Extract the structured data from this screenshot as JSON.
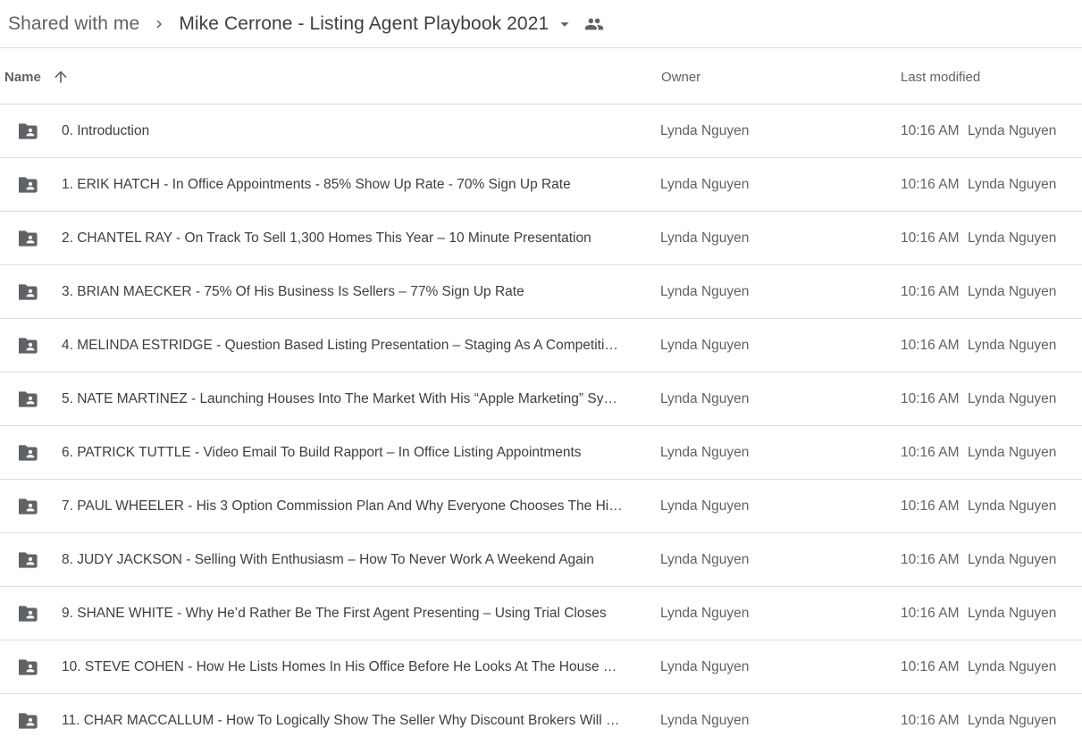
{
  "breadcrumb": {
    "parent": "Shared with me",
    "current": "Mike Cerrone - Listing Agent Playbook 2021",
    "separator_icon": "chevron-right-icon",
    "dropdown_icon": "caret-down-icon",
    "shared_icon": "people-icon"
  },
  "header": {
    "name": "Name",
    "sort_icon": "arrow-up-icon",
    "owner": "Owner",
    "last_modified": "Last modified"
  },
  "colors": {
    "text_primary": "#3c4043",
    "text_secondary": "#5f6368",
    "divider": "#dadce0",
    "icon": "#5f6368"
  },
  "files": [
    {
      "name": "0. Introduction",
      "owner": "Lynda Nguyen",
      "modified_time": "10:16 AM",
      "modified_by": "Lynda Nguyen",
      "icon": "shared-folder-icon"
    },
    {
      "name": "1. ERIK HATCH - In Office Appointments - 85% Show Up Rate - 70% Sign Up Rate",
      "owner": "Lynda Nguyen",
      "modified_time": "10:16 AM",
      "modified_by": "Lynda Nguyen",
      "icon": "shared-folder-icon"
    },
    {
      "name": "2. CHANTEL RAY - On Track To Sell 1,300 Homes This Year – 10 Minute Presentation",
      "owner": "Lynda Nguyen",
      "modified_time": "10:16 AM",
      "modified_by": "Lynda Nguyen",
      "icon": "shared-folder-icon"
    },
    {
      "name": "3. BRIAN MAECKER - 75% Of His Business Is Sellers – 77% Sign Up Rate",
      "owner": "Lynda Nguyen",
      "modified_time": "10:16 AM",
      "modified_by": "Lynda Nguyen",
      "icon": "shared-folder-icon"
    },
    {
      "name": "4. MELINDA ESTRIDGE - Question Based Listing Presentation – Staging As A Competiti…",
      "owner": "Lynda Nguyen",
      "modified_time": "10:16 AM",
      "modified_by": "Lynda Nguyen",
      "icon": "shared-folder-icon"
    },
    {
      "name": "5. NATE MARTINEZ - Launching Houses Into The Market With His “Apple Marketing” Sy…",
      "owner": "Lynda Nguyen",
      "modified_time": "10:16 AM",
      "modified_by": "Lynda Nguyen",
      "icon": "shared-folder-icon"
    },
    {
      "name": "6. PATRICK TUTTLE - Video Email To Build Rapport – In Office Listing Appointments",
      "owner": "Lynda Nguyen",
      "modified_time": "10:16 AM",
      "modified_by": "Lynda Nguyen",
      "icon": "shared-folder-icon"
    },
    {
      "name": "7. PAUL WHEELER - His 3 Option Commission Plan And Why Everyone Chooses The Hi…",
      "owner": "Lynda Nguyen",
      "modified_time": "10:16 AM",
      "modified_by": "Lynda Nguyen",
      "icon": "shared-folder-icon"
    },
    {
      "name": "8. JUDY JACKSON - Selling With Enthusiasm – How To Never Work A Weekend Again",
      "owner": "Lynda Nguyen",
      "modified_time": "10:16 AM",
      "modified_by": "Lynda Nguyen",
      "icon": "shared-folder-icon"
    },
    {
      "name": "9. SHANE WHITE - Why He’d Rather Be The First Agent Presenting – Using Trial Closes",
      "owner": "Lynda Nguyen",
      "modified_time": "10:16 AM",
      "modified_by": "Lynda Nguyen",
      "icon": "shared-folder-icon"
    },
    {
      "name": "10. STEVE COHEN - How He Lists Homes In His Office Before He Looks At The House …",
      "owner": "Lynda Nguyen",
      "modified_time": "10:16 AM",
      "modified_by": "Lynda Nguyen",
      "icon": "shared-folder-icon"
    },
    {
      "name": "11. CHAR MACCALLUM - How To Logically Show The Seller Why Discount Brokers Will …",
      "owner": "Lynda Nguyen",
      "modified_time": "10:16 AM",
      "modified_by": "Lynda Nguyen",
      "icon": "shared-folder-icon"
    }
  ]
}
